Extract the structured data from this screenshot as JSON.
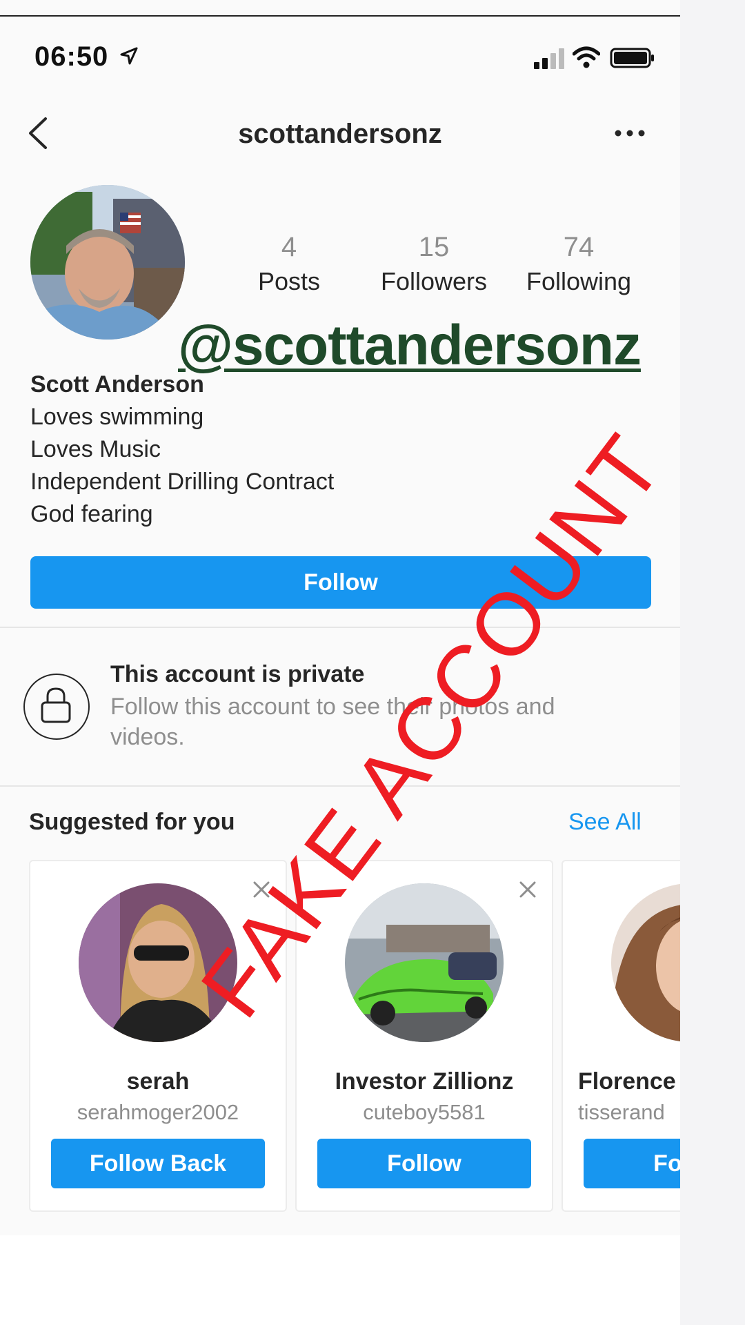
{
  "status_bar": {
    "time": "06:50"
  },
  "header": {
    "username": "scottandersonz"
  },
  "stats": [
    {
      "value": "4",
      "label": "Posts"
    },
    {
      "value": "15",
      "label": "Followers"
    },
    {
      "value": "74",
      "label": "Following"
    }
  ],
  "overlay_handle": "@scottandersonz",
  "bio": {
    "name": "Scott Anderson",
    "lines": [
      "Loves swimming",
      "Loves Music",
      "Independent Drilling Contract",
      "God fearing"
    ]
  },
  "follow_button": "Follow",
  "private": {
    "title": "This account is private",
    "subtitle": "Follow this account to see their photos and videos."
  },
  "suggested": {
    "title": "Suggested for you",
    "see_all": "See All",
    "cards": [
      {
        "name": "serah",
        "handle": "serahmoger2002",
        "button": "Follow Back"
      },
      {
        "name": "Investor Zillionz",
        "handle": "cuteboy5581",
        "button": "Follow"
      },
      {
        "name": "Florence",
        "handle": "tisserand",
        "button": "Follow"
      }
    ]
  },
  "stamp_text": "FAKE ACCOUNT",
  "colors": {
    "accent": "#1796f0",
    "stamp": "#ee1d23",
    "overlay": "#1f4a2a"
  }
}
